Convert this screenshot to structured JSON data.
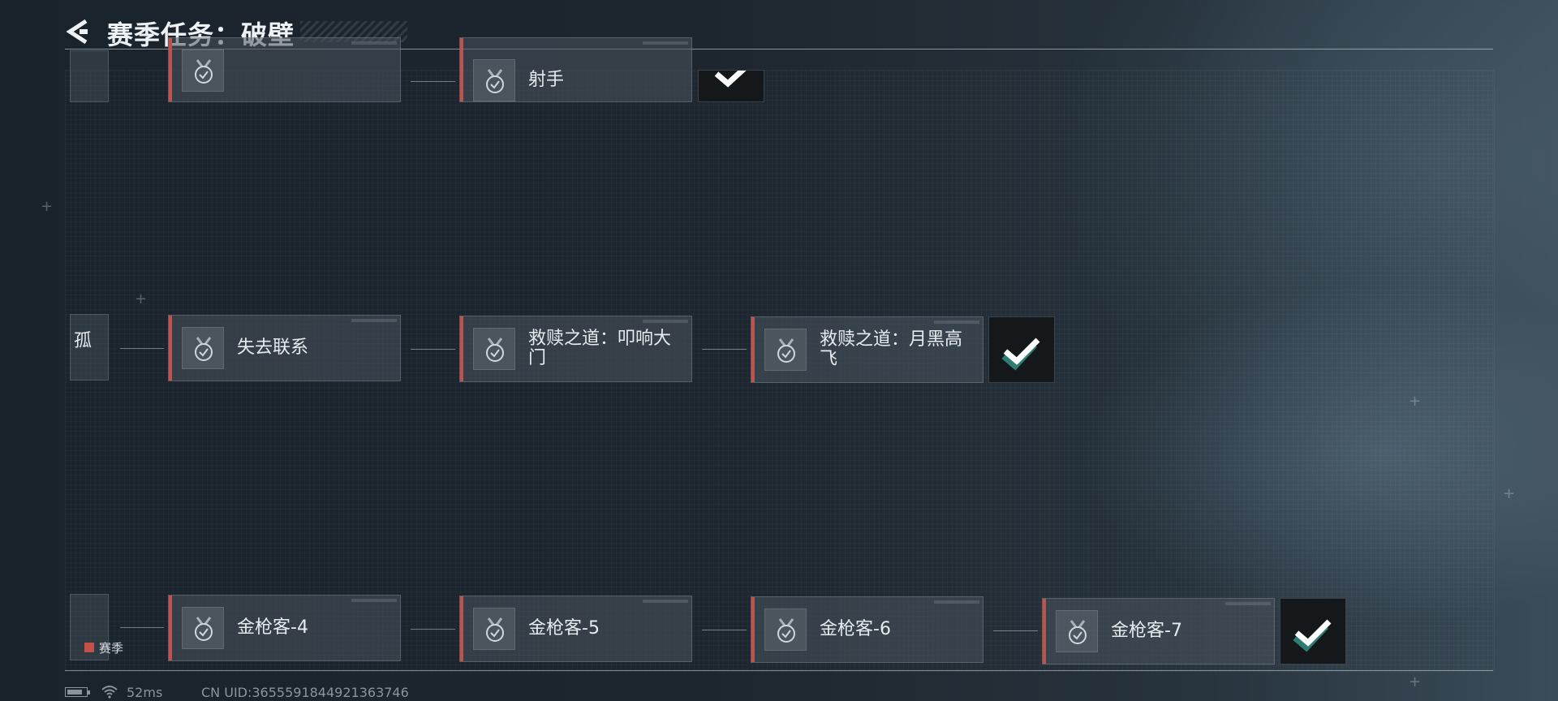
{
  "header": {
    "title": "赛季任务：破壁"
  },
  "rows": [
    {
      "partial_label": "",
      "nodes": [
        {
          "label": ""
        },
        {
          "label": "射手"
        }
      ],
      "completed": true
    },
    {
      "partial_label": "孤",
      "nodes": [
        {
          "label": "失去联系"
        },
        {
          "label": "救赎之道：叩响大门"
        },
        {
          "label": "救赎之道：月黑高飞"
        }
      ],
      "completed": true
    },
    {
      "partial_label": "",
      "nodes": [
        {
          "label": "金枪客-4"
        },
        {
          "label": "金枪客-5"
        },
        {
          "label": "金枪客-6"
        },
        {
          "label": "金枪客-7"
        }
      ],
      "completed": true
    }
  ],
  "legend": {
    "season_label": "赛季"
  },
  "status": {
    "ping": "52ms",
    "uid": "CN UID:3655591844921363746"
  },
  "colors": {
    "accent_red": "#c4504a",
    "check_bg": "#15181b",
    "check_teal": "#3aa79a"
  },
  "icons": [
    "back-arrow-icon",
    "medal-check-icon",
    "checkmark-icon",
    "battery-icon",
    "wifi-icon"
  ]
}
